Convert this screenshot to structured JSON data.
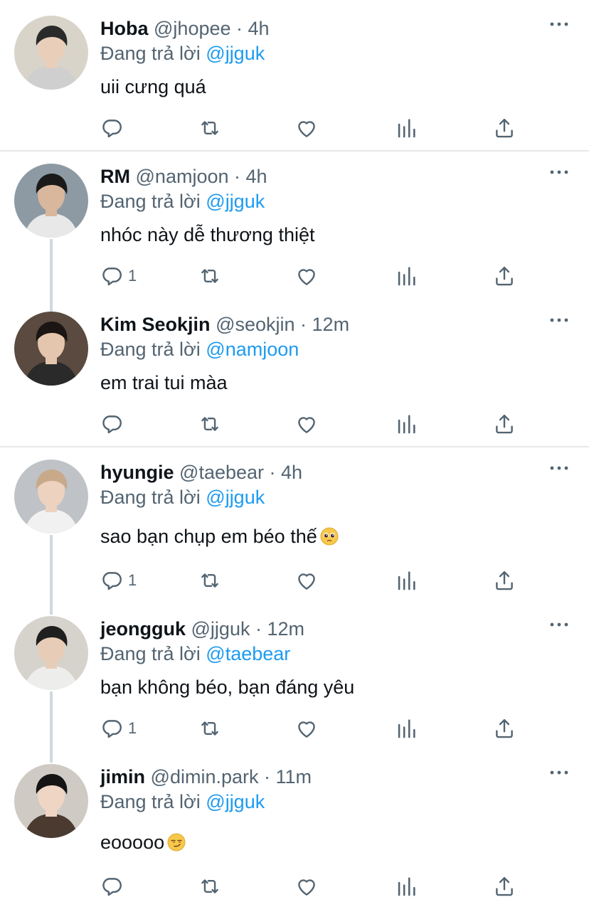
{
  "tweets": [
    {
      "name": "Hoba",
      "handle": "@jhopee",
      "time": "4h",
      "replying_label": "Đang trả lời",
      "replying_to": "@jjguk",
      "text": "uii cưng quá",
      "emoji": "",
      "reply_count": "",
      "avatar_colors": {
        "bg": "#d8d4c9",
        "hair": "#2a2a2a",
        "skin": "#e9cfb9",
        "cloth": "#cfcfcf"
      }
    },
    {
      "name": "RM",
      "handle": "@namjoon",
      "time": "4h",
      "replying_label": "Đang trả lời",
      "replying_to": "@jjguk",
      "text": "nhóc này dễ thương thiệt",
      "emoji": "",
      "reply_count": "1",
      "avatar_colors": {
        "bg": "#8d9aa3",
        "hair": "#1a1a1a",
        "skin": "#d9b79c",
        "cloth": "#e8e8e8"
      }
    },
    {
      "name": "Kim Seokjin",
      "handle": "@seokjin",
      "time": "12m",
      "replying_label": "Đang trả lời",
      "replying_to": "@namjoon",
      "text": "em trai tui màa",
      "emoji": "",
      "reply_count": "",
      "avatar_colors": {
        "bg": "#5a4a3f",
        "hair": "#1b1513",
        "skin": "#e4c6ae",
        "cloth": "#2a2a2a"
      }
    },
    {
      "name": "hyungie",
      "handle": "@taebear",
      "time": "4h",
      "replying_label": "Đang trả lời",
      "replying_to": "@jjguk",
      "text": "sao bạn chụp em béo thế",
      "emoji": "pleading-face",
      "reply_count": "1",
      "avatar_colors": {
        "bg": "#bfc3c7",
        "hair": "#c8a98a",
        "skin": "#ecd2bf",
        "cloth": "#f1f1f1"
      }
    },
    {
      "name": "jeongguk",
      "handle": "@jjguk",
      "time": "12m",
      "replying_label": "Đang trả lời",
      "replying_to": "@taebear",
      "text": "bạn không béo, bạn đáng yêu",
      "emoji": "",
      "reply_count": "1",
      "avatar_colors": {
        "bg": "#d6d3cc",
        "hair": "#1f1f1f",
        "skin": "#e7cdb8",
        "cloth": "#ededeb"
      }
    },
    {
      "name": "jimin",
      "handle": "@dimin.park",
      "time": "11m",
      "replying_label": "Đang trả lời",
      "replying_to": "@jjguk",
      "text": "eooooo",
      "emoji": "smirking-face",
      "reply_count": "",
      "avatar_colors": {
        "bg": "#cfcac4",
        "hair": "#141414",
        "skin": "#efd6c4",
        "cloth": "#4a3a30"
      }
    }
  ],
  "actions": {
    "reply_icon": "reply-icon",
    "retweet_icon": "retweet-icon",
    "like_icon": "like-icon",
    "views_icon": "views-icon",
    "share_icon": "share-icon",
    "more_icon": "more-icon"
  },
  "colors": {
    "text": "#0f1419",
    "secondary": "#536471",
    "mention": "#1d9bf0",
    "thread_line": "#cfd9de",
    "divider": "#e6e9eb"
  }
}
